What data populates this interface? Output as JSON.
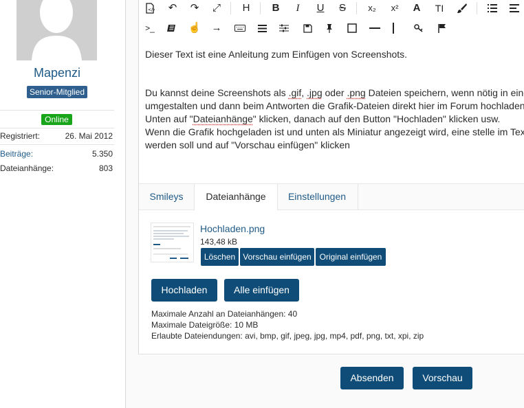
{
  "user": {
    "name": "Mapenzi",
    "rank": "Senior-Mitglied",
    "status": "Online",
    "stats": [
      {
        "label": "Registriert:",
        "value": "26. Mai 2012"
      },
      {
        "label": "Beiträge:",
        "value": "5.350"
      },
      {
        "label": "Dateianhänge:",
        "value": "803"
      }
    ]
  },
  "toolbar": {
    "row1": [
      "source-code-icon",
      "undo-icon",
      "redo-icon",
      "fullscreen-icon",
      "heading-icon",
      "bold-icon",
      "italic-icon",
      "underline-icon",
      "strikethrough-icon",
      "subscript-icon",
      "superscript-icon",
      "font-icon",
      "font-size-icon",
      "text-color-icon",
      "list-icon",
      "align-icon"
    ],
    "row2": [
      "code-icon",
      "highlight-icon",
      "spoiler-icon",
      "arrow-icon",
      "keyboard-icon",
      "horizontal-lines-icon",
      "settings-icon",
      "save-icon",
      "pin-icon",
      "box-icon",
      "horizontal-rule-icon",
      "vertical-bar-icon",
      "key-icon",
      "flag-icon"
    ],
    "glyphs": {
      "heading": "H",
      "bold": "B",
      "italic": "I",
      "underline": "U",
      "strike": "S",
      "sub": "x₂",
      "sup": "x²",
      "font": "A",
      "fontsize": "TI",
      "code": ">_"
    }
  },
  "editor": {
    "line1": "Dieser Text ist eine Anleitung zum Einfügen von Screenshots.",
    "line2_a": "Du kannst deine Screenshots als ",
    "line2_gif": ".gif",
    "line2_sep1": ", ",
    "line2_jpg": ".jpg",
    "line2_mid": " oder ",
    "line2_png": ".png",
    "line2_b": " Dateien speichern, wenn nötig in einem B",
    "line3": "umgestalten und dann beim Antworten die Grafik-Dateien direkt hier im Forum hochladen:",
    "line4_a": "Unten auf \"",
    "line4_link": "Dateianhänge",
    "line4_b": "\" klicken, danach auf den Button \"Hochladen\" klicken usw.",
    "line5": "Wenn die Grafik hochgeladen ist und unten als Miniatur angezeigt wird, eine stelle im Text ma",
    "line6": "werden soll und auf \"Vorschau einfügen\" klicken"
  },
  "tabs": [
    {
      "label": "Smileys"
    },
    {
      "label": "Dateianhänge"
    },
    {
      "label": "Einstellungen"
    }
  ],
  "attachment": {
    "name": "Hochladen.png",
    "size": "143,48 kB",
    "buttons": [
      "Löschen",
      "Vorschau einfügen",
      "Original einfügen"
    ]
  },
  "upload": {
    "upload_label": "Hochladen",
    "insert_all_label": "Alle einfügen",
    "info": [
      "Maximale Anzahl an Dateianhängen: 40",
      "Maximale Dateigröße: 10 MB",
      "Erlaubte Dateiendungen: avi, bmp, gif, jpeg, jpg, mp4, pdf, png, txt, xpi, zip"
    ]
  },
  "actions": {
    "submit_label": "Absenden",
    "preview_label": "Vorschau"
  },
  "colors": {
    "accent": "#0f4d78",
    "link": "#1f5a87",
    "online": "#19a51a",
    "rank_badge": "#2e5f8e"
  }
}
